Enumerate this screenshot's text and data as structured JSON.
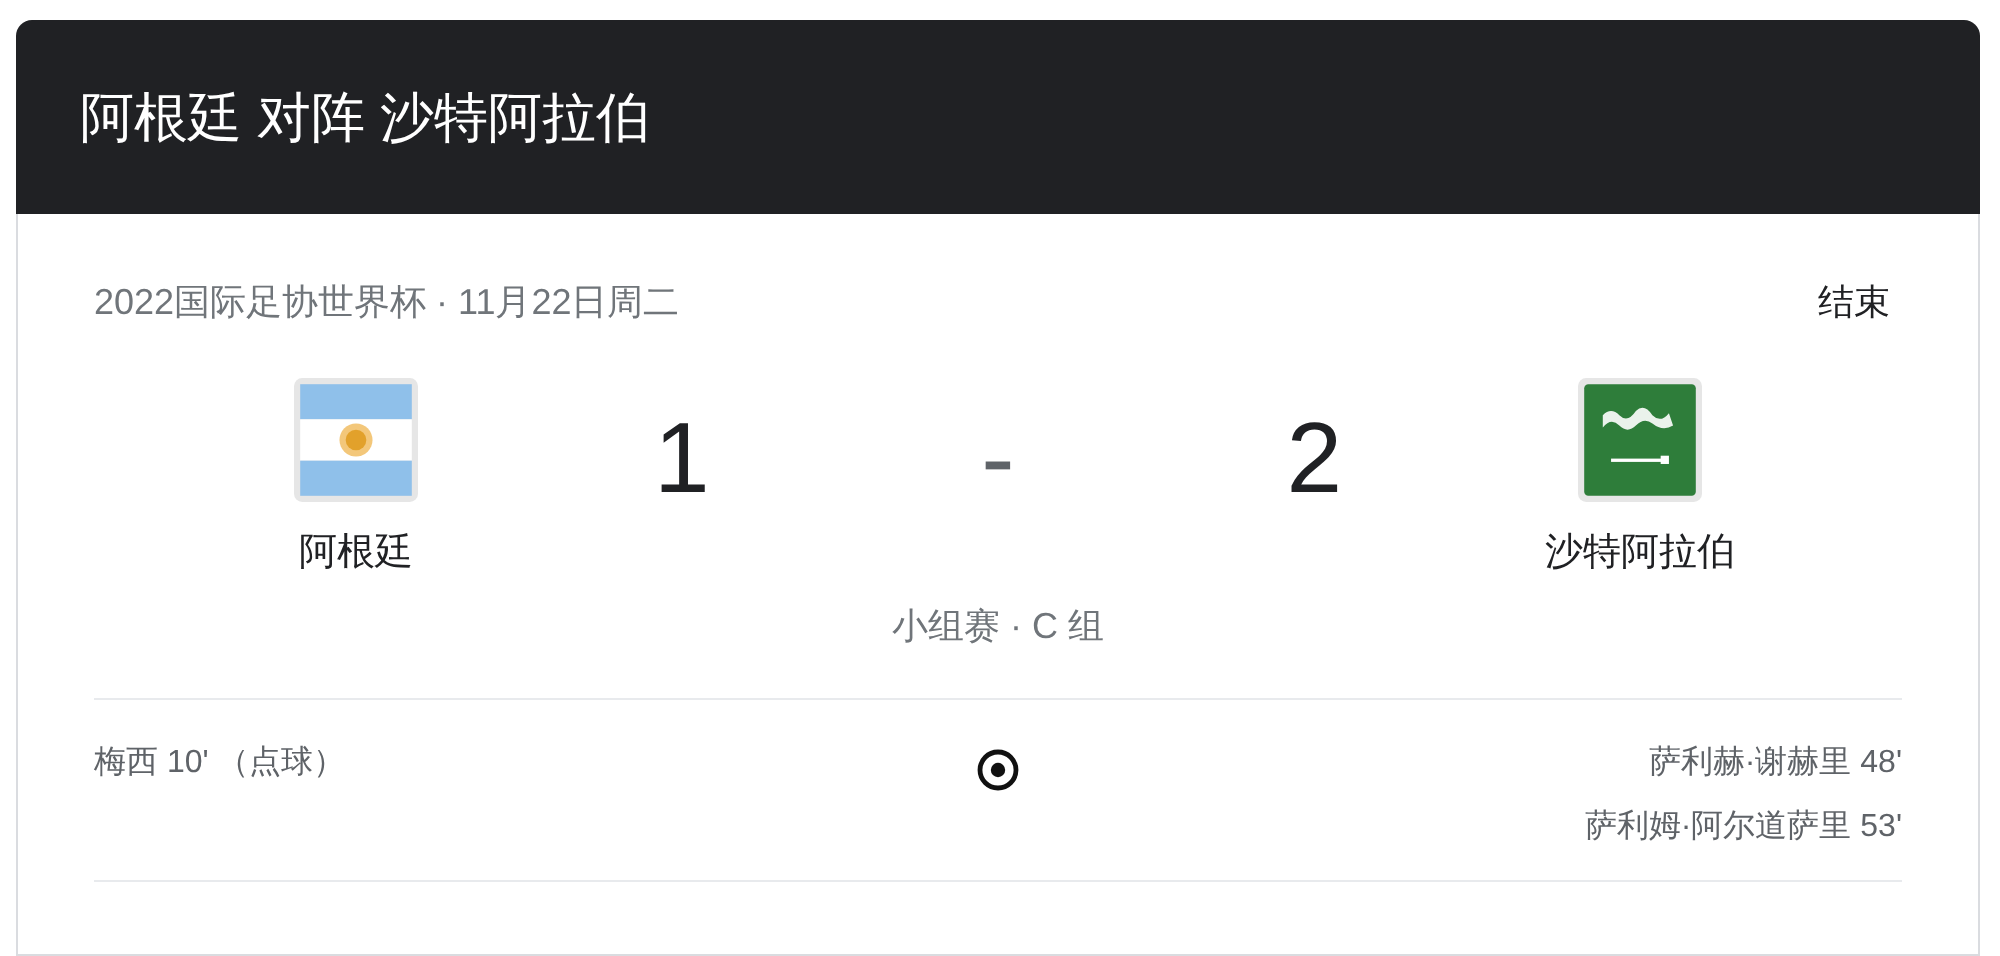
{
  "header": {
    "title": "阿根廷 对阵 沙特阿拉伯"
  },
  "match": {
    "info": "2022国际足协世界杯 · 11月22日周二",
    "status": "结束",
    "home": {
      "name": "阿根廷",
      "kind": "argentina",
      "score": "1"
    },
    "separator": "-",
    "away": {
      "name": "沙特阿拉伯",
      "kind": "saudi",
      "score": "2"
    },
    "stage": "小组赛 · C 组"
  },
  "goals": {
    "home": [
      "梅西 10' （点球）"
    ],
    "away": [
      "萨利赫·谢赫里 48'",
      "萨利姆·阿尔道萨里 53'"
    ]
  }
}
